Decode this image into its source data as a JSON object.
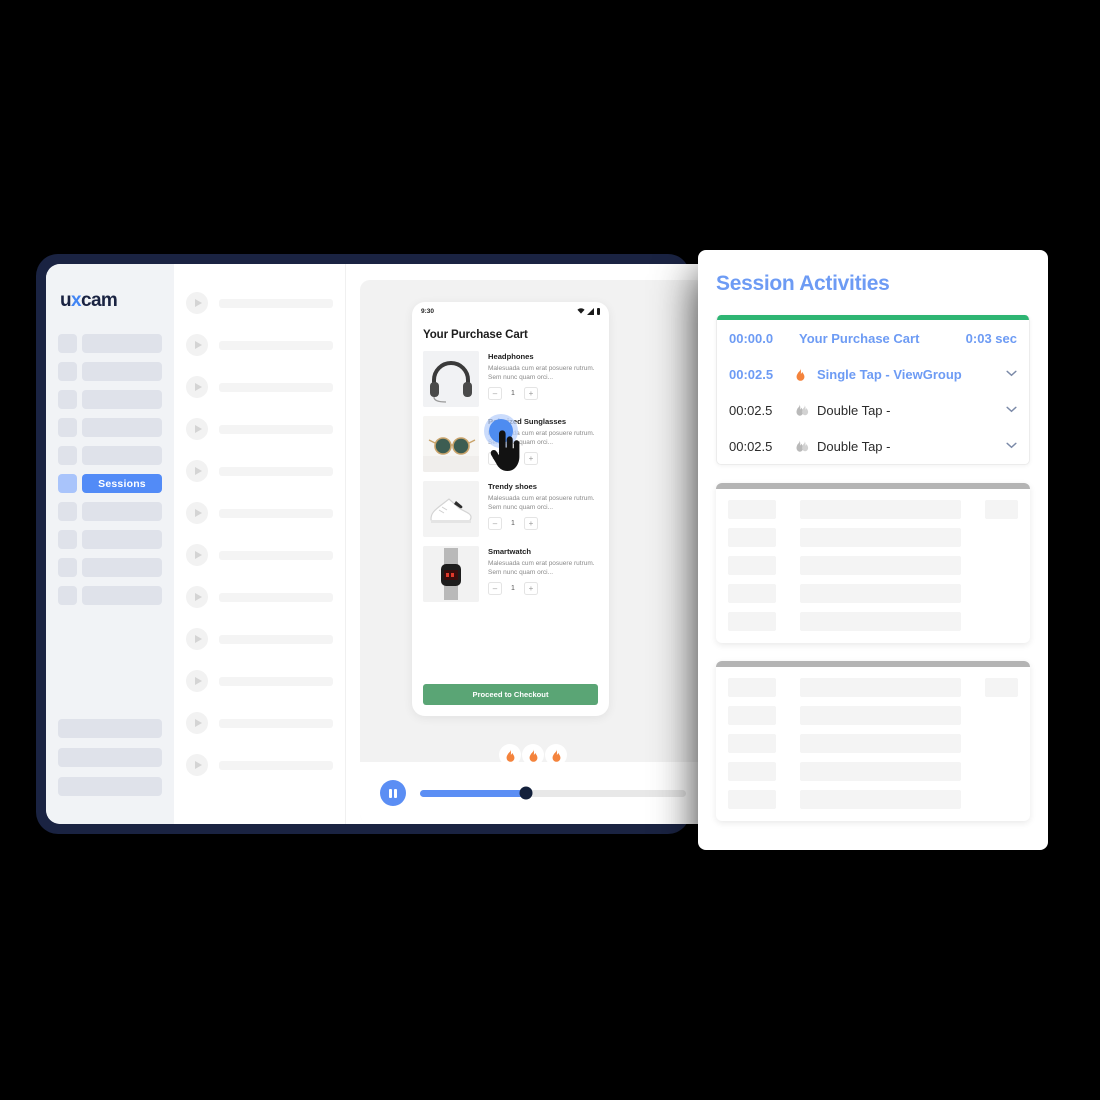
{
  "brand": {
    "logo_text_1": "u",
    "logo_x": "x",
    "logo_text_2": "cam",
    "accent_blue": "#4285f4"
  },
  "sidebar": {
    "items": [
      {
        "label": "",
        "active": false
      },
      {
        "label": "",
        "active": false
      },
      {
        "label": "",
        "active": false
      },
      {
        "label": "",
        "active": false
      },
      {
        "label": "",
        "active": false
      },
      {
        "label": "Sessions",
        "active": true
      },
      {
        "label": "",
        "active": false
      },
      {
        "label": "",
        "active": false
      },
      {
        "label": "",
        "active": false
      },
      {
        "label": "",
        "active": false
      }
    ],
    "footer_placeholders": 3
  },
  "session_list": {
    "row_count": 12
  },
  "phone": {
    "status": {
      "time": "9:30",
      "icons": [
        "wifi-icon",
        "signal-icon",
        "battery-icon"
      ]
    },
    "screen_title": "Your Purchase Cart",
    "items": [
      {
        "name": "Headphones",
        "description": "Malesuada cum erat posuere rutrum. Sem nunc quam orci...",
        "quantity": "1",
        "minus": "–",
        "plus": "+",
        "image": "headphones-photo"
      },
      {
        "name": "Polarized Sunglasses",
        "description": "Malesuada cum erat posuere rutrum. Sem nunc quam orci...",
        "quantity": "1",
        "minus": "–",
        "plus": "+",
        "image": "sunglasses-photo"
      },
      {
        "name": "Trendy shoes",
        "description": "Malesuada cum erat posuere rutrum. Sem nunc quam orci...",
        "quantity": "1",
        "minus": "–",
        "plus": "+",
        "image": "sneaker-photo"
      },
      {
        "name": "Smartwatch",
        "description": "Malesuada cum erat posuere rutrum. Sem nunc quam orci...",
        "quantity": "1",
        "minus": "–",
        "plus": "+",
        "image": "smartwatch-photo"
      }
    ],
    "checkout_label": "Proceed to Checkout",
    "checkout_color": "#5aa575"
  },
  "player": {
    "pause_icon": "pause-icon",
    "progress_percent": 40,
    "flame_count": 3,
    "flame_color": "#f4833c",
    "track_color": "#5b8ef4"
  },
  "activities": {
    "title": "Session Activities",
    "accent_color": "#2eb573",
    "rows": [
      {
        "time": "00:00.0",
        "icon": "",
        "label": "Your Purchase Cart",
        "duration": "0:03 sec",
        "chevron": "",
        "highlight": true
      },
      {
        "time": "00:02.5",
        "icon": "flame-icon",
        "label": "Single Tap - ViewGroup",
        "duration": "",
        "chevron": "⌄",
        "highlight": true
      },
      {
        "time": "00:02.5",
        "icon": "double-flame-icon",
        "label": "Double Tap -",
        "duration": "",
        "chevron": "⌄",
        "highlight": false
      },
      {
        "time": "00:02.5",
        "icon": "double-flame-icon",
        "label": "Double Tap -",
        "duration": "",
        "chevron": "⌄",
        "highlight": false
      }
    ],
    "skeleton_cards": 2,
    "skeleton_rows_per_card": 5
  }
}
